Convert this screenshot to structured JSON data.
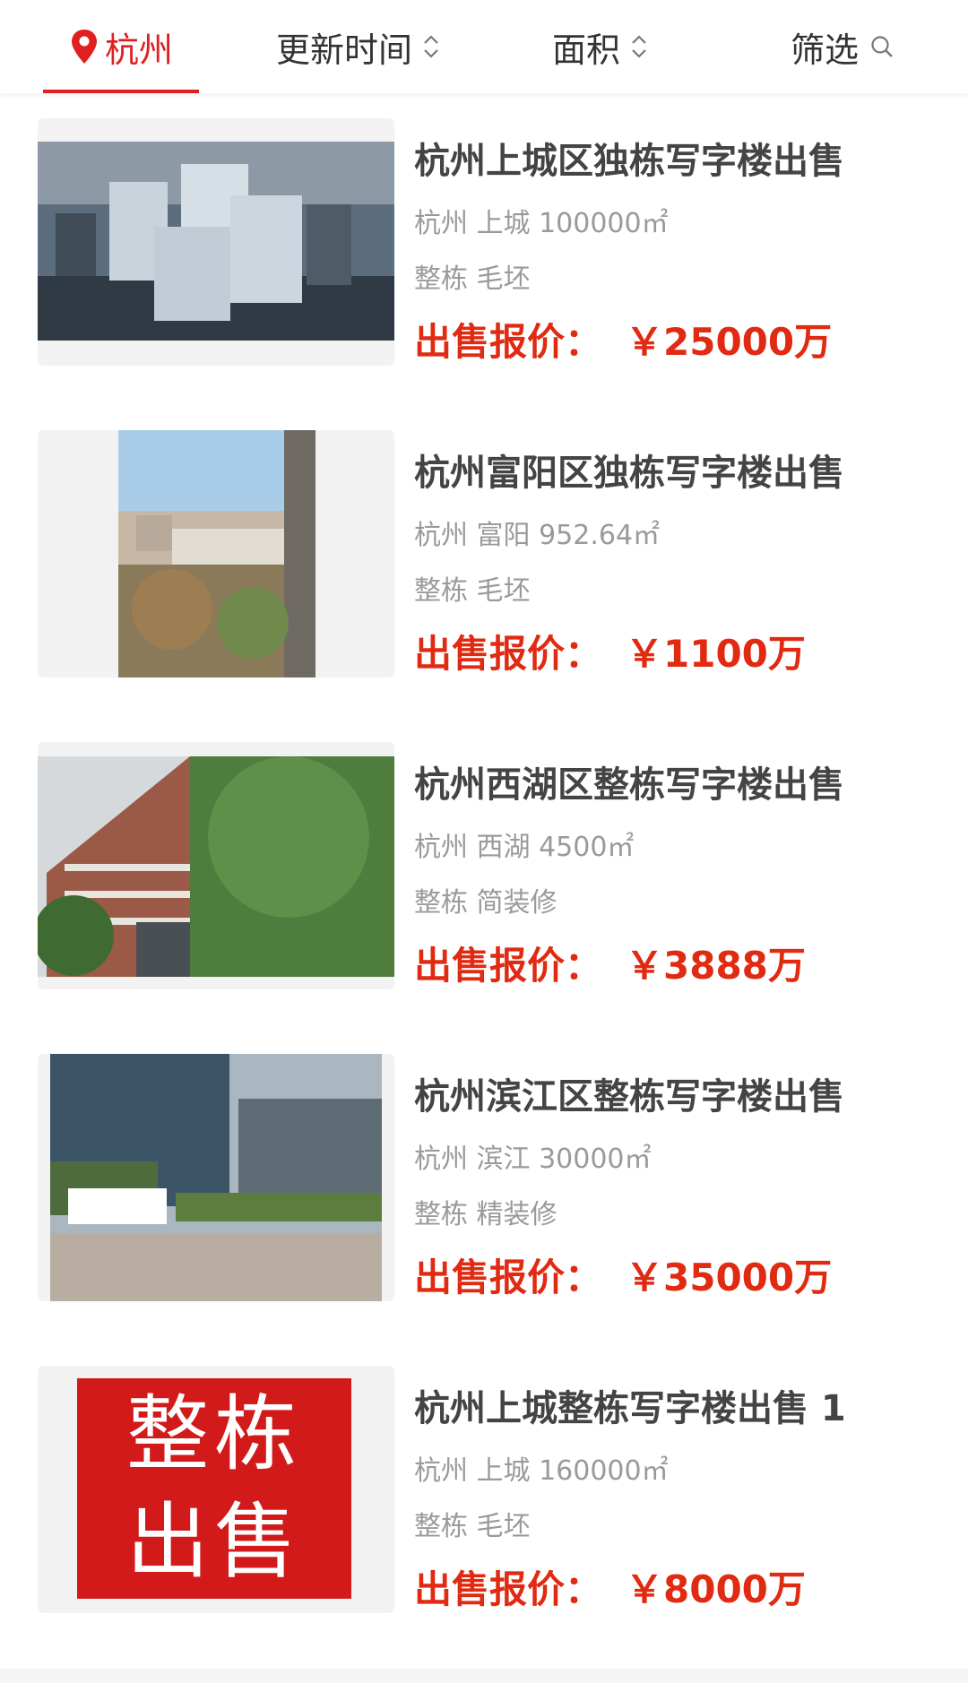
{
  "header": {
    "city_tab": "杭州",
    "sort_update": "更新时间",
    "sort_area": "面积",
    "filter": "筛选"
  },
  "colors": {
    "accent": "#e02020",
    "price": "#e02a12",
    "title": "#444444",
    "meta": "#9a9a9a"
  },
  "icons": {
    "city": "location-pin-icon",
    "sort": "sort-updown-icon",
    "filter": "search-icon"
  },
  "listings": [
    {
      "title": "杭州上城区独栋写字楼出售",
      "meta": "杭州 上城 100000㎡",
      "tags": "整栋 毛坯",
      "price_label": "出售报价：",
      "price": "￥25000万"
    },
    {
      "title": "杭州富阳区独栋写字楼出售",
      "meta": "杭州 富阳 952.64㎡",
      "tags": "整栋 毛坯",
      "price_label": "出售报价：",
      "price": "￥1100万"
    },
    {
      "title": "杭州西湖区整栋写字楼出售",
      "meta": "杭州 西湖 4500㎡",
      "tags": "整栋 简装修",
      "price_label": "出售报价：",
      "price": "￥3888万"
    },
    {
      "title": "杭州滨江区整栋写字楼出售",
      "meta": "杭州 滨江 30000㎡",
      "tags": "整栋 精装修",
      "price_label": "出售报价：",
      "price": "￥35000万"
    },
    {
      "title": "杭州上城整栋写字楼出售 1",
      "meta": "杭州 上城 160000㎡",
      "tags": "整栋 毛坯",
      "price_label": "出售报价：",
      "price": "￥8000万",
      "image_text": [
        "整栋",
        "出售"
      ]
    }
  ]
}
